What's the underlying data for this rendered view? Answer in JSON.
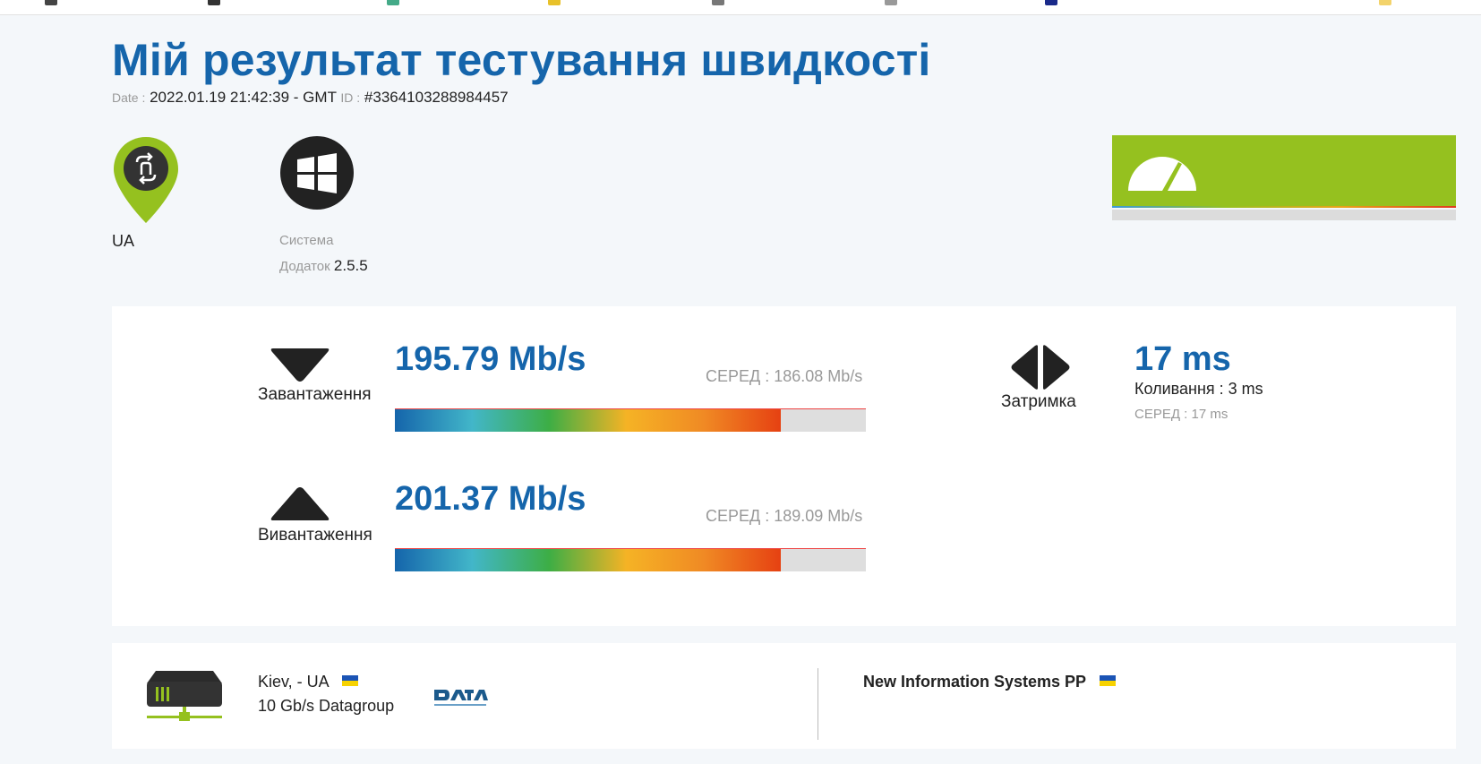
{
  "page": {
    "title": "Мій результат тестування швидкості",
    "date_label": "Date :",
    "date_value": "2022.01.19 21:42:39 - GMT",
    "id_label": "ID :",
    "id_value": "#3364103288984457"
  },
  "client": {
    "country": "UA",
    "system_label": "Система",
    "app_label": "Додаток",
    "app_version": "2.5.5"
  },
  "results": {
    "download": {
      "label": "Завантаження",
      "speed": "195.79 Mb/s",
      "avg": "СЕРЕД : 186.08 Mb/s",
      "level_percent": 82
    },
    "upload": {
      "label": "Вивантаження",
      "speed": "201.37 Mb/s",
      "avg": "СЕРЕД : 189.09 Mb/s",
      "level_percent": 82
    },
    "latency": {
      "label": "Затримка",
      "value": "17 ms",
      "jitter": "Коливання : 3 ms",
      "avg": "СЕРЕД : 17 ms"
    }
  },
  "server": {
    "location": "Kiev, - UA",
    "host": "10 Gb/s Datagroup",
    "isp": "New Information Systems PP"
  },
  "colors": {
    "accent_blue": "#1565ab",
    "brand_green": "#95c11f",
    "flag_blue": "#1b54b5",
    "flag_yellow": "#f7d200"
  },
  "icons": {
    "location": "location-pin-icon",
    "os": "windows-icon",
    "speedometer": "speedometer-icon",
    "download": "download-arrow-icon",
    "upload": "upload-arrow-icon",
    "latency": "latency-icon",
    "server": "server-icon",
    "provider_logo": "datagroup-logo"
  }
}
